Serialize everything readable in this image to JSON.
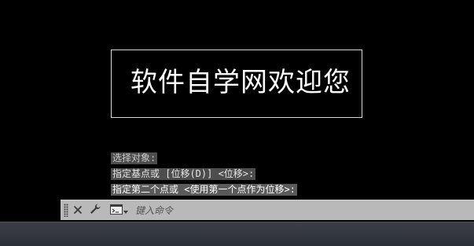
{
  "canvas": {
    "mtext": "软件自学网欢迎您",
    "history": [
      "选择对象:",
      "指定基点或 [位移(D)] <位移>:",
      "指定第二个点或 <使用第一个点作为位移>:"
    ]
  },
  "command_line": {
    "input_value": "",
    "placeholder": "键入命令",
    "icons": {
      "grip": "grip-handle-icon",
      "close": "close-icon",
      "customize": "wrench-icon",
      "recent": "command-prompt-icon"
    },
    "colors": {
      "bar_background": "#b9b9b9",
      "history_background": "#4d4d4d"
    }
  },
  "colors": {
    "drawing_background": "#000000",
    "text": "#ffffff"
  }
}
